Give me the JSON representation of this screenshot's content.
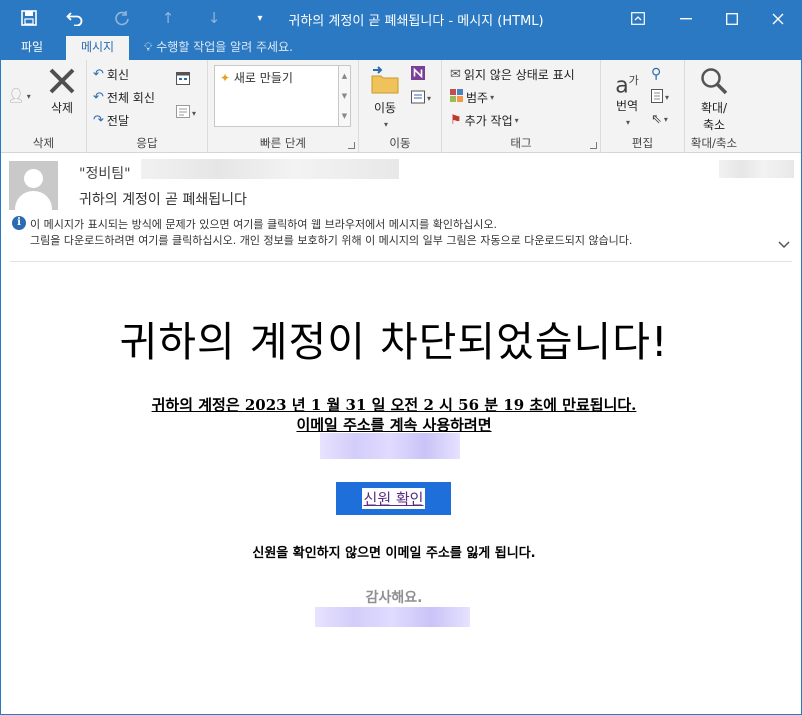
{
  "window": {
    "title": "귀하의 계정이 곧 폐쇄됩니다 - 메시지 (HTML)"
  },
  "tabs": {
    "file": "파일",
    "message": "메시지",
    "tell_me": "수행할 작업을 알려 주세요."
  },
  "ribbon": {
    "delete": {
      "label": "삭제",
      "button": "삭제"
    },
    "respond": {
      "label": "응답",
      "reply": "회신",
      "reply_all": "전체 회신",
      "forward": "전달"
    },
    "quick_steps": {
      "label": "빠른 단계",
      "new": "새로 만들기"
    },
    "move": {
      "label": "이동",
      "button": "이동"
    },
    "tags": {
      "label": "태그",
      "mark_unread": "읽지 않은 상태로 표시",
      "categorize": "범주",
      "follow_up": "추가 작업"
    },
    "editing": {
      "label": "편집",
      "translate": "번역"
    },
    "zoom": {
      "label": "확대/축소",
      "button_line1": "확대/",
      "button_line2": "축소"
    }
  },
  "header": {
    "sender": "\"정비팀\"",
    "subject": "귀하의 계정이 곧 폐쇄됩니다",
    "info_line1": "이 메시지가 표시되는 방식에 문제가 있으면 여기를 클릭하여 웹 브라우저에서 메시지를 확인하십시오.",
    "info_line2": "그림을 다운로드하려면 여기를 클릭하십시오. 개인 정보를 보호하기 위해 이 메시지의 일부 그림은 자동으로 다운로드되지 않습니다."
  },
  "body": {
    "headline": "귀하의 계정이 차단되었습니다!",
    "line1": "귀하의 계정은 2023 년 1 월 31 일 오전 2 시 56 분 19 초에 만료됩니다.",
    "line2": "이메일 주소를 계속 사용하려면",
    "button": "신원 확인",
    "warning": "신원을 확인하지 않으면 이메일 주소를 잃게 됩니다.",
    "thanks": "감사해요."
  },
  "colors": {
    "accent": "#2b79c2",
    "button": "#1e6fd9",
    "link": "#5b2a86"
  }
}
